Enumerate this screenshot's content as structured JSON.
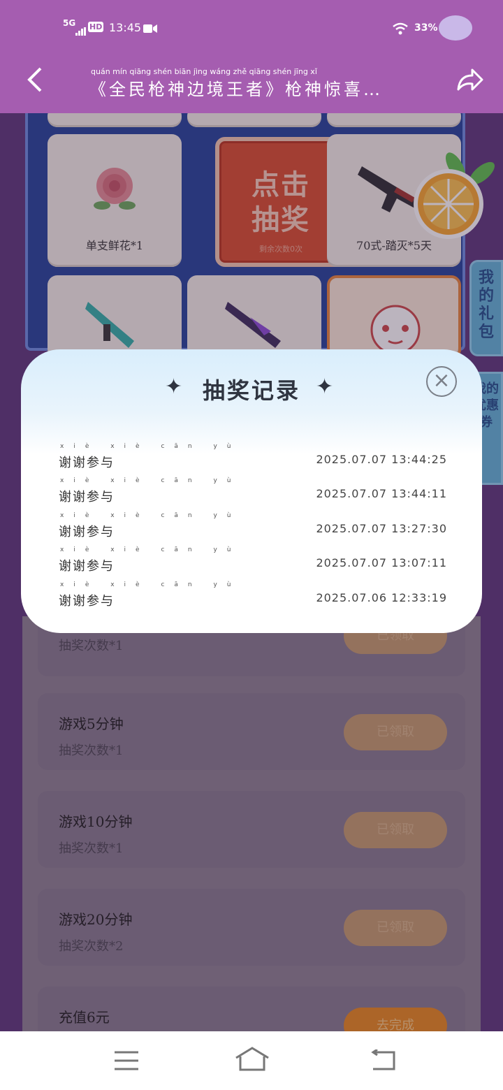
{
  "status_bar": {
    "network": "5G",
    "hd": "HD",
    "time": "13:45",
    "battery": "33%"
  },
  "nav": {
    "title": "《全民枪神边境王者》枪神惊喜…",
    "title_pinyin": "quán mín qiāng shén biān jìng wáng zhě   qiāng shén jīng xǐ"
  },
  "prize_board": {
    "draw_button": {
      "line1": "点击",
      "line2": "抽奖",
      "sub": "剩余次数0次"
    },
    "items": [
      {
        "label": "单支鲜花*1",
        "icon": "rose-icon"
      },
      {
        "label": "70式-踏灭*5天",
        "icon": "rifle-icon"
      },
      {
        "label": "",
        "icon": "rifle-icon"
      },
      {
        "label": "",
        "icon": "rifle-icon"
      },
      {
        "label": "",
        "icon": "mascot-icon"
      }
    ]
  },
  "side_tabs": [
    "我的礼包",
    "我的优惠券"
  ],
  "modal": {
    "title": "抽奖记录",
    "records": [
      {
        "name": "谢谢参与",
        "pinyin": "xiè xiè cān yù",
        "time": "2025.07.07 13:44:25"
      },
      {
        "name": "谢谢参与",
        "pinyin": "xiè xiè cān yù",
        "time": "2025.07.07 13:44:11"
      },
      {
        "name": "谢谢参与",
        "pinyin": "xiè xiè cān yù",
        "time": "2025.07.07 13:27:30"
      },
      {
        "name": "谢谢参与",
        "pinyin": "xiè xiè cān yù",
        "time": "2025.07.07 13:07:11"
      },
      {
        "name": "谢谢参与",
        "pinyin": "xiè xiè cān yù",
        "time": "2025.07.06 12:33:19"
      }
    ]
  },
  "tasks": [
    {
      "title": "",
      "reward": "抽奖次数*1",
      "button": "已领取"
    },
    {
      "title": "游戏5分钟",
      "reward": "抽奖次数*1",
      "button": "已领取"
    },
    {
      "title": "游戏10分钟",
      "reward": "抽奖次数*1",
      "button": "已领取"
    },
    {
      "title": "游戏20分钟",
      "reward": "抽奖次数*2",
      "button": "已领取"
    },
    {
      "title": "充值6元",
      "reward": "",
      "button": "去完成"
    }
  ],
  "colors": {
    "header": "#a55db0",
    "accent": "#d94a2a",
    "modal_bg": "#ffffff"
  }
}
